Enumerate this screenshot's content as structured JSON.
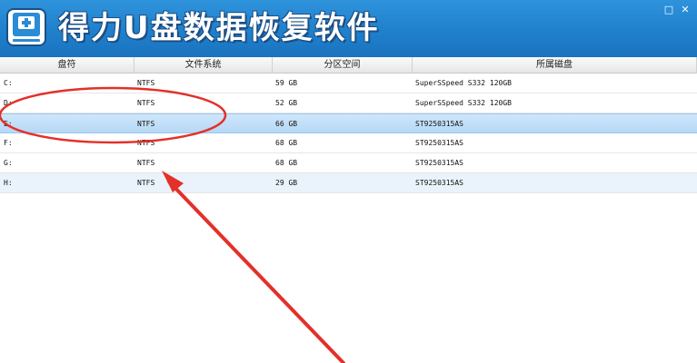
{
  "app": {
    "title": "得力U盘数据恢复软件"
  },
  "window_controls": {
    "minimize": "□",
    "close": "✕"
  },
  "columns": [
    "盘符",
    "文件系统",
    "分区空间",
    "所属磁盘"
  ],
  "rows": [
    {
      "drive": "C:",
      "fs": "NTFS",
      "size": "59 GB",
      "disk": "SuperSSpeed S332 120GB"
    },
    {
      "drive": "D:",
      "fs": "NTFS",
      "size": "52 GB",
      "disk": "SuperSSpeed S332 120GB"
    },
    {
      "drive": "E:",
      "fs": "NTFS",
      "size": "66 GB",
      "disk": "ST9250315AS"
    },
    {
      "drive": "F:",
      "fs": "NTFS",
      "size": "68 GB",
      "disk": "ST9250315AS"
    },
    {
      "drive": "G:",
      "fs": "NTFS",
      "size": "68 GB",
      "disk": "ST9250315AS"
    },
    {
      "drive": "H:",
      "fs": "NTFS",
      "size": "29 GB",
      "disk": "ST9250315AS"
    }
  ],
  "selected_row": 2,
  "colors": {
    "titlebar": "#1f80cc",
    "selection": "#b6d8f5",
    "annotation": "#e3302a"
  }
}
